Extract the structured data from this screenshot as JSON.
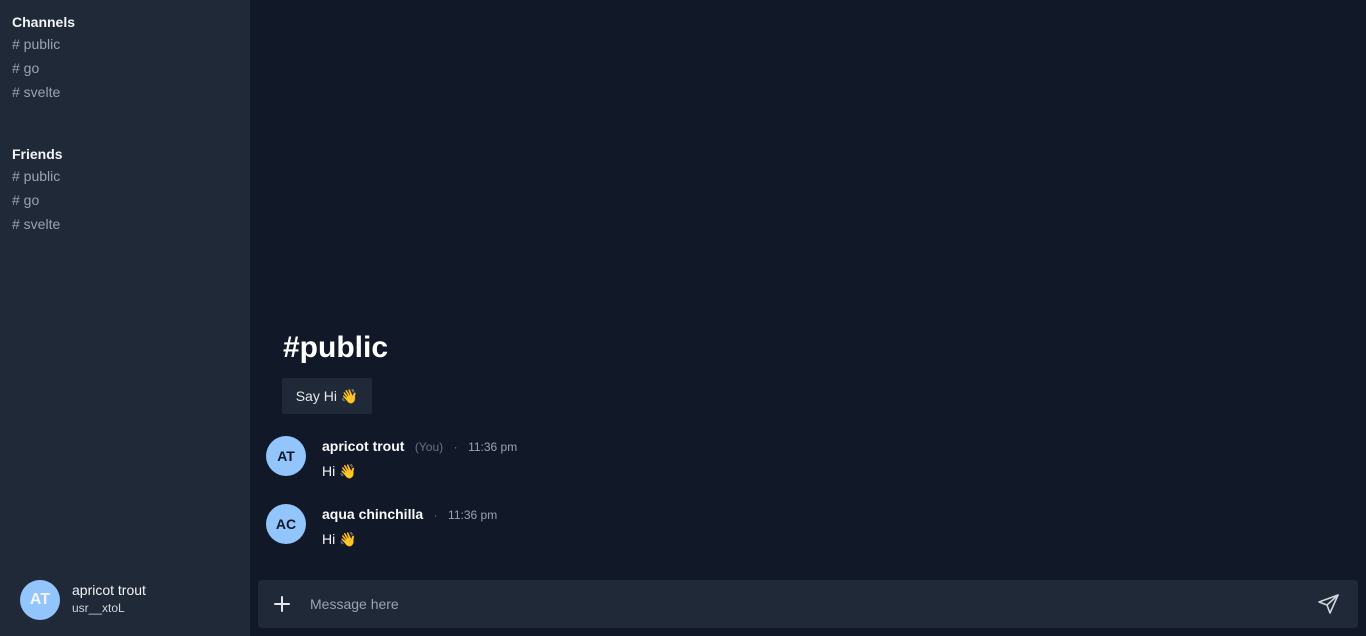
{
  "sidebar": {
    "channels": {
      "title": "Channels",
      "items": [
        "# public",
        "# go",
        "# svelte"
      ]
    },
    "friends": {
      "title": "Friends",
      "items": [
        "# public",
        "# go",
        "# svelte"
      ]
    },
    "current_user": {
      "initials": "AT",
      "name": "apricot trout",
      "id": "usr__xtoL"
    }
  },
  "main": {
    "channel_title": "#public",
    "say_hi_label": "Say Hi 👋",
    "messages": [
      {
        "initials": "AT",
        "author": "apricot trout",
        "you_tag": "(You)",
        "separator": "·",
        "time": "11:36 pm",
        "text": "Hi 👋"
      },
      {
        "initials": "AC",
        "author": "aqua chinchilla",
        "separator": "·",
        "time": "11:36 pm",
        "text": "Hi 👋"
      }
    ],
    "composer": {
      "placeholder": "Message here",
      "value": ""
    }
  },
  "colors": {
    "sidebar_bg": "#1f2937",
    "main_bg": "#111827",
    "avatar_bg": "#93c5fd"
  },
  "icons": [
    "plus-icon",
    "send-icon"
  ]
}
